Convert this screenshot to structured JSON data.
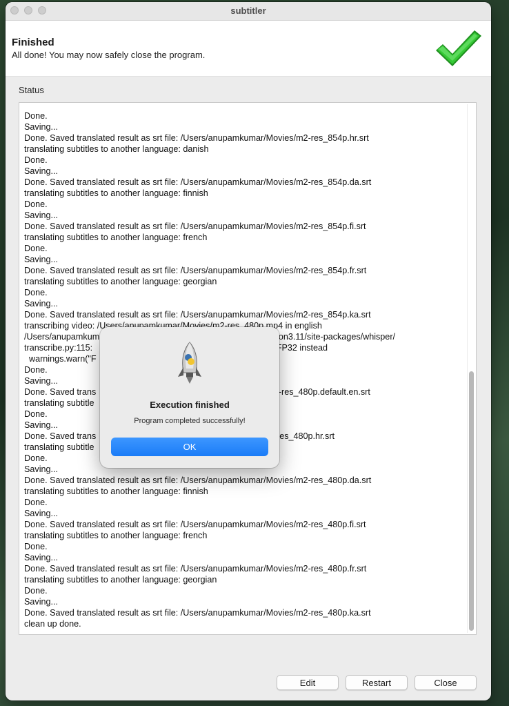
{
  "window": {
    "title": "subtitler"
  },
  "header": {
    "title": "Finished",
    "subtitle": "All done! You may now safely close the program.",
    "status_icon": "green-checkmark-icon"
  },
  "status": {
    "label": "Status",
    "log_lines": [
      "Done.",
      "Saving...",
      "Done. Saved translated result as srt file: /Users/anupamkumar/Movies/m2-res_854p.hr.srt",
      "translating subtitles to another language: danish",
      "Done.",
      "Saving...",
      "Done. Saved translated result as srt file: /Users/anupamkumar/Movies/m2-res_854p.da.srt",
      "translating subtitles to another language: finnish",
      "Done.",
      "Saving...",
      "Done. Saved translated result as srt file: /Users/anupamkumar/Movies/m2-res_854p.fi.srt",
      "translating subtitles to another language: french",
      "Done.",
      "Saving...",
      "Done. Saved translated result as srt file: /Users/anupamkumar/Movies/m2-res_854p.fr.srt",
      "translating subtitles to another language: georgian",
      "Done.",
      "Saving...",
      "Done. Saved translated result as srt file: /Users/anupamkumar/Movies/m2-res_854p.ka.srt",
      "transcribing video: /Users/anupamkumar/Movies/m2-res_480p.mp4 in english",
      "/Users/anupamkum                                                          nv/lib/python3.11/site-packages/whisper/",
      "transcribe.py:115:                                                              U; using FP32 instead",
      "  warnings.warn(\"F                                                            nstead\")",
      "Done.",
      "Saving...",
      "Done. Saved trans                                                      ar/Movies/m2-res_480p.default.en.srt",
      "translating subtitle",
      "Done.",
      "Saving...",
      "Done. Saved trans                                                      r/Movies/m2-res_480p.hr.srt",
      "translating subtitle",
      "Done.",
      "Saving...",
      "Done. Saved translated result as srt file: /Users/anupamkumar/Movies/m2-res_480p.da.srt",
      "translating subtitles to another language: finnish",
      "Done.",
      "Saving...",
      "Done. Saved translated result as srt file: /Users/anupamkumar/Movies/m2-res_480p.fi.srt",
      "translating subtitles to another language: french",
      "Done.",
      "Saving...",
      "Done. Saved translated result as srt file: /Users/anupamkumar/Movies/m2-res_480p.fr.srt",
      "translating subtitles to another language: georgian",
      "Done.",
      "Saving...",
      "Done. Saved translated result as srt file: /Users/anupamkumar/Movies/m2-res_480p.ka.srt",
      "clean up done."
    ]
  },
  "buttons": {
    "edit": "Edit",
    "restart": "Restart",
    "close": "Close"
  },
  "dialog": {
    "icon": "python-rocket-icon",
    "title": "Execution finished",
    "message": "Program completed successfully!",
    "ok_label": "OK"
  },
  "colors": {
    "accent": "#1a7cf7",
    "check": "#2fb52f"
  }
}
